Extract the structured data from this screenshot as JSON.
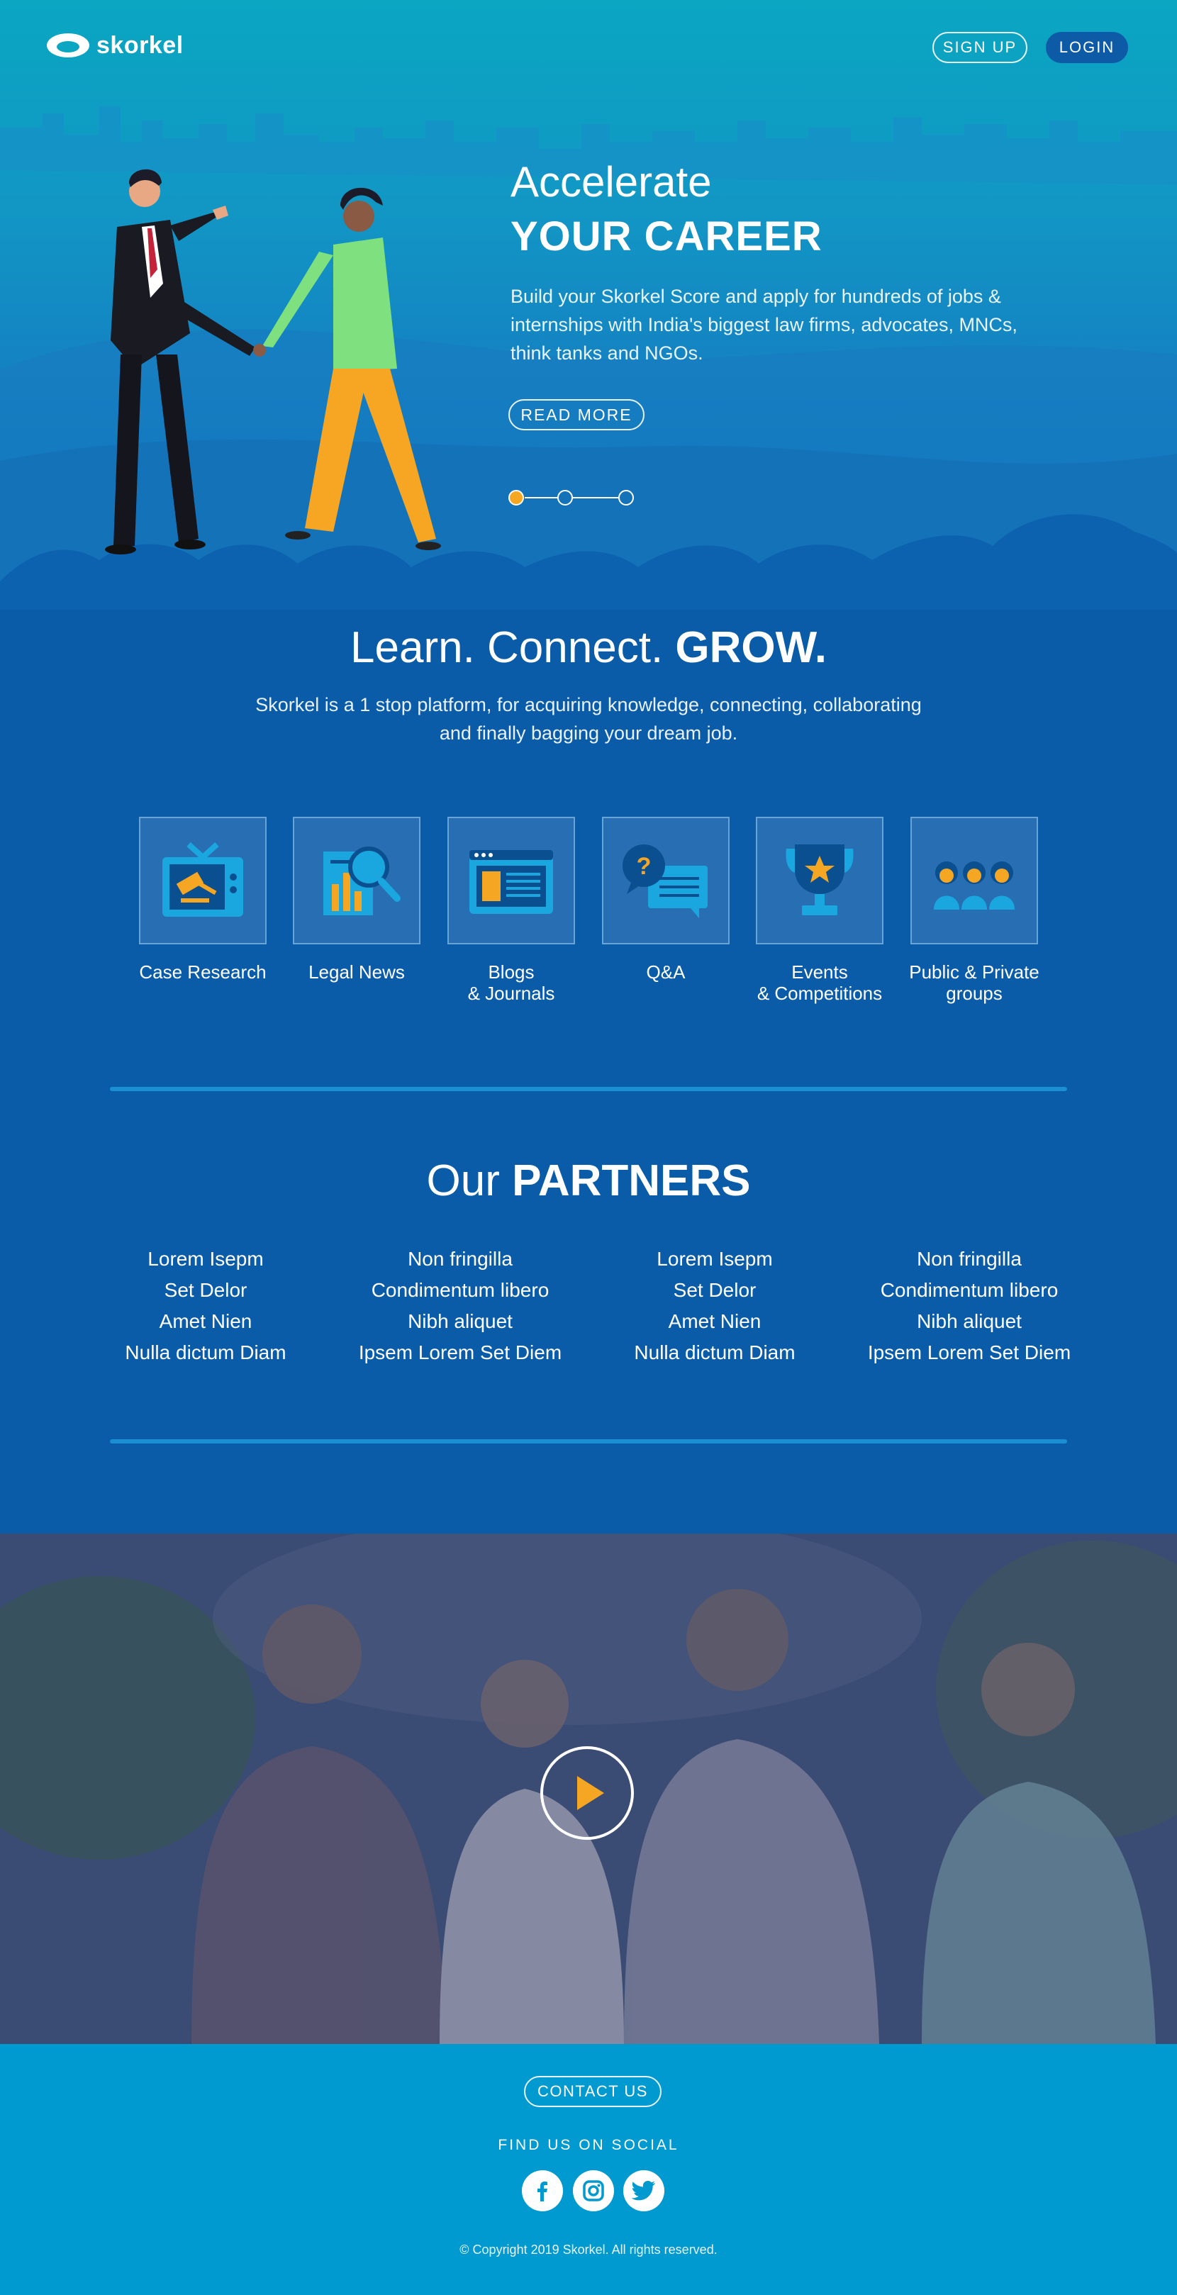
{
  "brand": {
    "name": "skorkel"
  },
  "nav": {
    "signup": "SIGN UP",
    "login": "LOGIN"
  },
  "hero": {
    "title_light": "Accelerate",
    "title_bold": "YOUR CAREER",
    "description": "Build your Skorkel Score and apply for hundreds of jobs & internships with India's biggest law firms, advocates, MNCs, think tanks and NGOs.",
    "cta": "READ MORE",
    "slides": 3,
    "active_slide": 1
  },
  "intro": {
    "title_light": "Learn. Connect.",
    "title_bold": "GROW.",
    "description_line1": "Skorkel is a 1 stop platform, for acquiring knowledge, connecting, collaborating",
    "description_line2": "and finally bagging your dream job."
  },
  "services": [
    {
      "label1": "Case Research",
      "label2": "",
      "icon": "gavel-tv-icon"
    },
    {
      "label1": "Legal News",
      "label2": "",
      "icon": "news-chart-icon"
    },
    {
      "label1": "Blogs",
      "label2": "& Journals",
      "icon": "browser-window-icon"
    },
    {
      "label1": "Q&A",
      "label2": "",
      "icon": "chat-question-icon"
    },
    {
      "label1": "Events",
      "label2": "& Competitions",
      "icon": "trophy-icon"
    },
    {
      "label1": "Public & Private",
      "label2": "groups",
      "icon": "people-group-icon"
    }
  ],
  "partners": {
    "title_light": "Our",
    "title_bold": "PARTNERS",
    "columns": [
      [
        "Lorem Isepm",
        "Set Delor",
        "Amet Nien",
        "Nulla dictum Diam"
      ],
      [
        "Non fringilla",
        "Condimentum libero",
        "Nibh aliquet",
        "Ipsem Lorem Set Diem"
      ],
      [
        "Lorem Isepm",
        "Set Delor",
        "Amet Nien",
        "Nulla dictum Diam"
      ],
      [
        "Non fringilla",
        "Condimentum libero",
        "Nibh aliquet",
        "Ipsem Lorem Set Diem"
      ]
    ]
  },
  "video": {
    "icon": "play-icon"
  },
  "footer": {
    "contact": "CONTACT US",
    "social_heading": "FIND US ON SOCIAL",
    "social": [
      "facebook-icon",
      "instagram-icon",
      "twitter-icon"
    ],
    "copyright": "© Copyright 2019 Skorkel. All rights reserved."
  },
  "colors": {
    "hero_top": "#0aa6c2",
    "body_blue": "#0a5ca8",
    "footer": "#0099d0",
    "accent_orange": "#f5a623"
  }
}
